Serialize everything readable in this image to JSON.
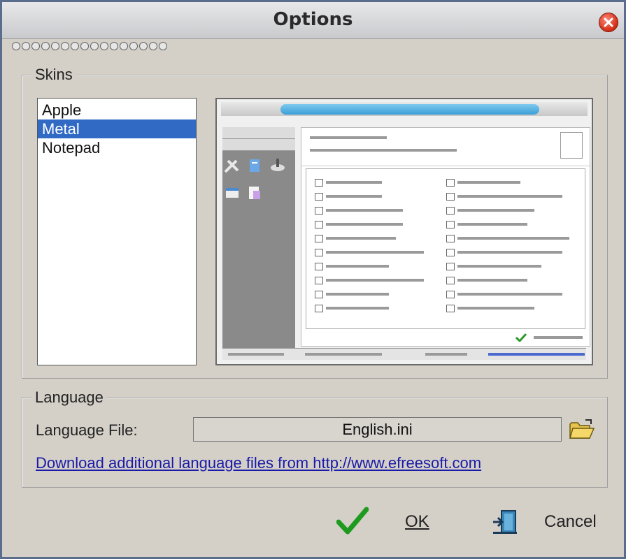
{
  "window": {
    "title": "Options"
  },
  "skins": {
    "legend": "Skins",
    "items": [
      "Apple",
      "Metal",
      "Notepad"
    ],
    "selected_index": 1
  },
  "language": {
    "legend": "Language",
    "file_label": "Language File:",
    "file_value": "English.ini",
    "download_link": "Download additional language files from http://www.efreesoft.com"
  },
  "buttons": {
    "ok_label": "OK",
    "cancel_label": "Cancel"
  },
  "icons": {
    "close": "close-icon",
    "folder": "folder-open-icon",
    "ok": "checkmark-icon",
    "cancel": "exit-door-icon"
  },
  "colors": {
    "selection": "#316ac5",
    "link": "#1a1aa8",
    "ok_green": "#1e9a1e",
    "close_red": "#d12a12"
  }
}
